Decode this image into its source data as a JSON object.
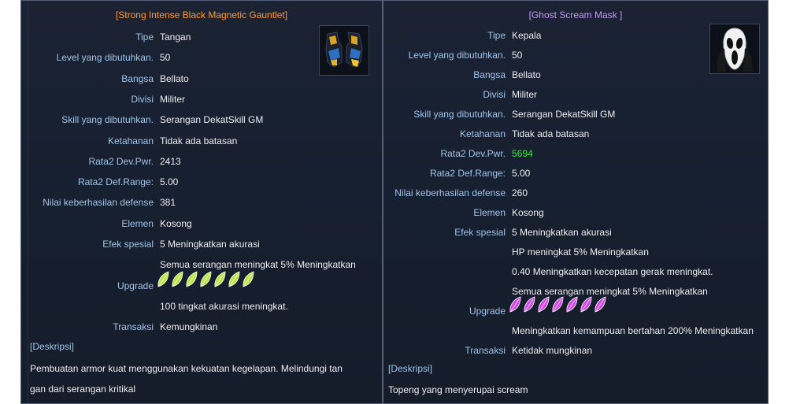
{
  "left": {
    "title": "[Strong Intense Black Magnetic Gauntlet]",
    "title_color": "#ff9a2e",
    "icon": "gauntlet-icon",
    "rows": [
      {
        "label": "Tipe",
        "value": "Tangan"
      },
      {
        "label": "Level yang dibutuhkan.",
        "value": "50"
      },
      {
        "label": "Bangsa",
        "value": "Bellato"
      },
      {
        "label": "Divisi",
        "value": "Militer"
      },
      {
        "label": "Skill yang dibutuhkan.",
        "value": "Serangan DekatSkill GM"
      },
      {
        "label": "Ketahanan",
        "value": "Tidak ada batasan"
      },
      {
        "label": "Rata2 Dev.Pwr.",
        "value": "2413"
      },
      {
        "label": "Rata2 Def.Range:",
        "value": "5.00"
      },
      {
        "label": "Nilai keberhasilan defense",
        "value": "381"
      },
      {
        "label": "Elemen",
        "value": "Kosong"
      },
      {
        "label": "Efek spesial",
        "value": "5 Meningkatkan akurasi"
      }
    ],
    "effect_extra": [
      "Semua serangan meningkat 5% Meningkatkan"
    ],
    "upgrade_label": "Upgrade",
    "upgrade_count": 7,
    "upgrade_color": "#b7e64a",
    "upgrade_after": [
      "100 tingkat akurasi meningkat."
    ],
    "trade_label": "Transaksi",
    "trade_value": "Kemungkinan",
    "desc_head": "[Deskripsi]",
    "desc_lines": [
      "Pembuatan armor kuat menggunakan kekuatan kegelapan. Melindungi tan",
      "gan dari serangan kritikal"
    ]
  },
  "right": {
    "title": "[Ghost Scream Mask ]",
    "title_color": "#c59af0",
    "icon": "ghost-mask-icon",
    "rows": [
      {
        "label": "Tipe",
        "value": "Kepala"
      },
      {
        "label": "Level yang dibutuhkan.",
        "value": "50"
      },
      {
        "label": "Bangsa",
        "value": "Bellato"
      },
      {
        "label": "Divisi",
        "value": "Militer"
      },
      {
        "label": "Skill yang dibutuhkan.",
        "value": "Serangan DekatSkill GM"
      },
      {
        "label": "Ketahanan",
        "value": "Tidak ada batasan"
      },
      {
        "label": "Rata2 Dev.Pwr.",
        "value": "5694",
        "highlight": "#39e63a"
      },
      {
        "label": "Rata2 Def.Range:",
        "value": "5.00"
      },
      {
        "label": "Nilai keberhasilan defense",
        "value": "260"
      },
      {
        "label": "Elemen",
        "value": "Kosong"
      },
      {
        "label": "Efek spesial",
        "value": "5 Meningkatkan akurasi"
      }
    ],
    "effect_extra": [
      "HP meningkat 5% Meningkatkan",
      "0.40 Meningkatkan kecepatan gerak meningkat.",
      "Semua serangan meningkat 5% Meningkatkan"
    ],
    "upgrade_label": "Upgrade",
    "upgrade_count": 7,
    "upgrade_color": "#d24ae6",
    "upgrade_after": [
      "Meningkatkan kemampuan bertahan 200% Meningkatkan"
    ],
    "trade_label": "Transaksi",
    "trade_value": "Ketidak mungkinan",
    "desc_head": "[Deskripsi]",
    "desc_lines": [
      "Topeng yang menyerupai scream"
    ]
  }
}
